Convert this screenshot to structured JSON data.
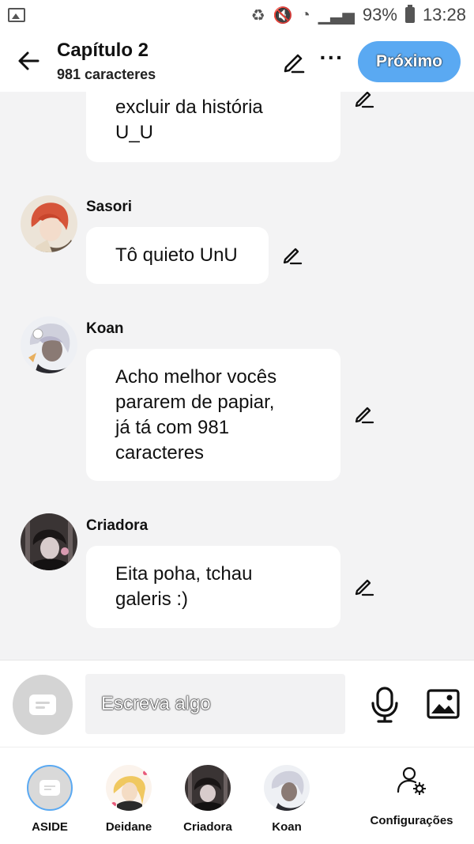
{
  "status_bar": {
    "battery_percent": "93%",
    "time": "13:28"
  },
  "header": {
    "title": "Capítulo 2",
    "subtitle": "981 caracteres",
    "next_label": "Próximo"
  },
  "messages": [
    {
      "text_lines": [
        "excluir da história",
        "U_U"
      ]
    },
    {
      "author": "Sasori",
      "text_lines": [
        "Tô quieto UnU"
      ]
    },
    {
      "author": "Koan",
      "text_lines": [
        "Acho melhor vocês",
        "pararem de papiar,",
        "já tá com 981",
        "caracteres"
      ]
    },
    {
      "author": "Criadora",
      "text_lines": [
        "Eita poha, tchau",
        "galeris :)"
      ]
    }
  ],
  "composer": {
    "placeholder": "Escreva algo"
  },
  "tabs": [
    {
      "label": "ASIDE"
    },
    {
      "label": "Deidane"
    },
    {
      "label": "Criadora"
    },
    {
      "label": "Koan"
    },
    {
      "label": "Configurações"
    }
  ],
  "colors": {
    "accent": "#5aa9f2",
    "background": "#f3f3f4",
    "bubble": "#ffffff"
  }
}
